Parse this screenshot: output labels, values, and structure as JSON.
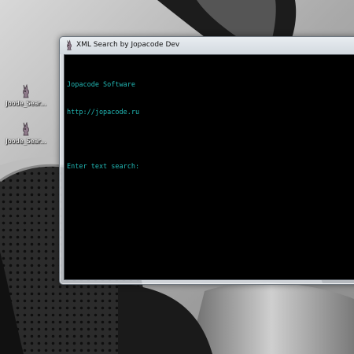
{
  "desktop": {
    "icons": [
      {
        "label": "Joode_Sear...",
        "icon": "app-bunny-icon"
      },
      {
        "label": "Joode_Sear...",
        "icon": "app-bunny-icon"
      }
    ]
  },
  "window": {
    "title": "XML Search by Jopacode Dev",
    "icon": "app-bunny-icon",
    "console": {
      "text_color": "#21b7b4",
      "background": "#000000",
      "lines": [
        "Jopacode Software",
        "http://jopacode.ru",
        "",
        "Enter text search:"
      ]
    }
  }
}
